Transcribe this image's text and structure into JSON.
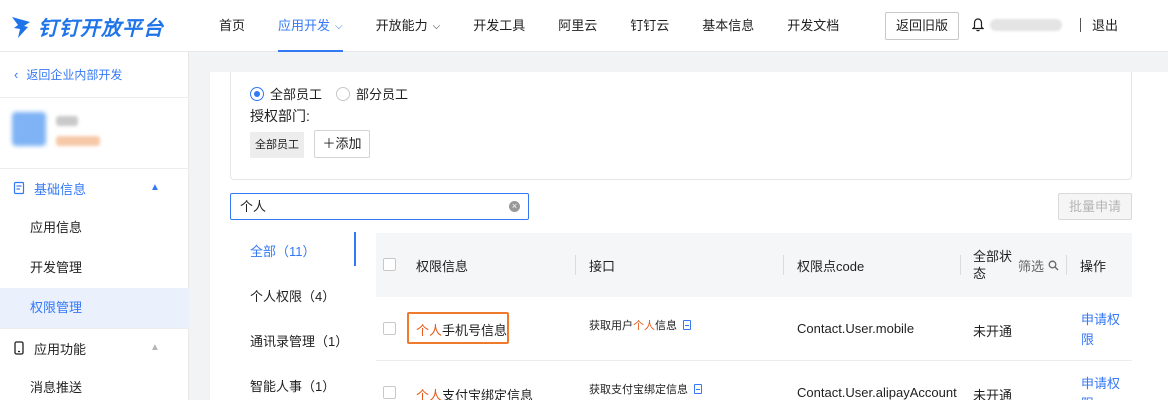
{
  "brand": {
    "name": "钉钉开放平台",
    "color": "#1e74e8"
  },
  "nav": {
    "items": [
      {
        "label": "首页",
        "active": false,
        "has_menu": false
      },
      {
        "label": "应用开发",
        "active": true,
        "has_menu": true
      },
      {
        "label": "开放能力",
        "active": false,
        "has_menu": true
      },
      {
        "label": "开发工具",
        "active": false,
        "has_menu": false
      },
      {
        "label": "阿里云",
        "active": false,
        "has_menu": false
      },
      {
        "label": "钉钉云",
        "active": false,
        "has_menu": false
      },
      {
        "label": "基本信息",
        "active": false,
        "has_menu": false
      },
      {
        "label": "开发文档",
        "active": false,
        "has_menu": false
      }
    ],
    "old_version_label": "返回旧版",
    "logout_label": "退出"
  },
  "sidebar": {
    "back_label": "返回企业内部开发",
    "sections": [
      {
        "label": "基础信息",
        "icon": "doc-icon",
        "expanded": true
      },
      {
        "label": "应用功能",
        "icon": "phone-icon",
        "expanded": true
      }
    ],
    "items": [
      {
        "label": "应用信息",
        "active": false
      },
      {
        "label": "开发管理",
        "active": false
      },
      {
        "label": "权限管理",
        "active": true
      },
      {
        "label": "消息推送",
        "active": false
      }
    ]
  },
  "auth": {
    "radio_all": "全部员工",
    "radio_part": "部分员工",
    "selected": "全部员工",
    "dept_label": "授权部门:",
    "chip": "全部员工",
    "add_label": "添加"
  },
  "search": {
    "value": "个人"
  },
  "batch_label": "批量申请",
  "categories": [
    {
      "label": "全部（11）",
      "active": true
    },
    {
      "label": "个人权限（4）",
      "active": false
    },
    {
      "label": "通讯录管理（1）",
      "active": false
    },
    {
      "label": "智能人事（1）",
      "active": false
    }
  ],
  "table": {
    "headers": {
      "info": "权限信息",
      "api": "接口",
      "code": "权限点code",
      "status_line1": "全部状",
      "status_line2": "态",
      "filter": "筛选",
      "action": "操作"
    },
    "rows": [
      {
        "info_hl": "个人",
        "info_rest": "手机号信息",
        "api_pre": "获取用户",
        "api_hl": "个人",
        "api_post": "信息",
        "code": "Contact.User.mobile",
        "status": "未开通",
        "action_line1": "申请权",
        "action_line2": "限"
      },
      {
        "info_hl": "个人",
        "info_rest": "支付宝绑定信息",
        "api_pre": "获取支付宝绑定信息",
        "api_hl": "",
        "api_post": "",
        "code": "Contact.User.alipayAccount",
        "status": "未开通",
        "action_line1": "申请权",
        "action_line2": "限"
      }
    ]
  },
  "colors": {
    "accent": "#3478f6",
    "highlight": "#e8591a",
    "focus_box": "#f07a2c"
  }
}
